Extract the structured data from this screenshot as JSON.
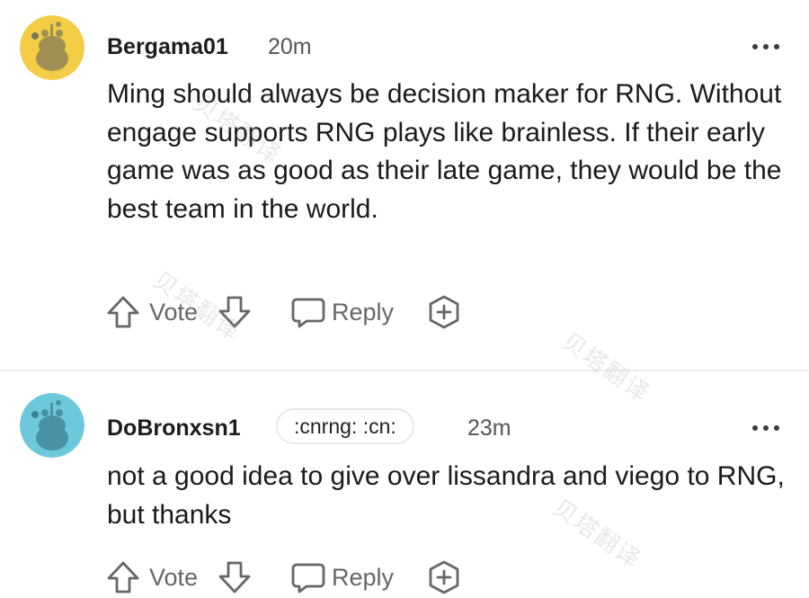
{
  "comments": [
    {
      "username": "Bergama01",
      "time": "20m",
      "flair": "",
      "avatar_color": "#f2cd45",
      "avatar_icon": "snoo-avatar-icon",
      "body": "Ming should always be decision maker for RNG. Without engage supports RNG plays like brainless. If their early game was as good as their late game, they would be the best team in the world.",
      "actions": {
        "vote_label": "Vote",
        "reply_label": "Reply"
      }
    },
    {
      "username": "DoBronxsn1",
      "time": "23m",
      "flair": ":cnrng: :cn:",
      "avatar_color": "#6ec8dc",
      "avatar_icon": "snoo-avatar-icon",
      "body": "not a good idea to give over lissandra and viego to RNG, but thanks",
      "actions": {
        "vote_label": "Vote",
        "reply_label": "Reply"
      }
    }
  ],
  "icons": {
    "upvote": "upvote-arrow-icon",
    "downvote": "downvote-arrow-icon",
    "reply": "speech-bubble-icon",
    "award": "award-plus-icon",
    "more": "more-dots-icon"
  },
  "watermark": "贝塔翻译",
  "colors": {
    "text": "#1a1a1b",
    "muted": "#666666",
    "divider": "#ececec"
  }
}
